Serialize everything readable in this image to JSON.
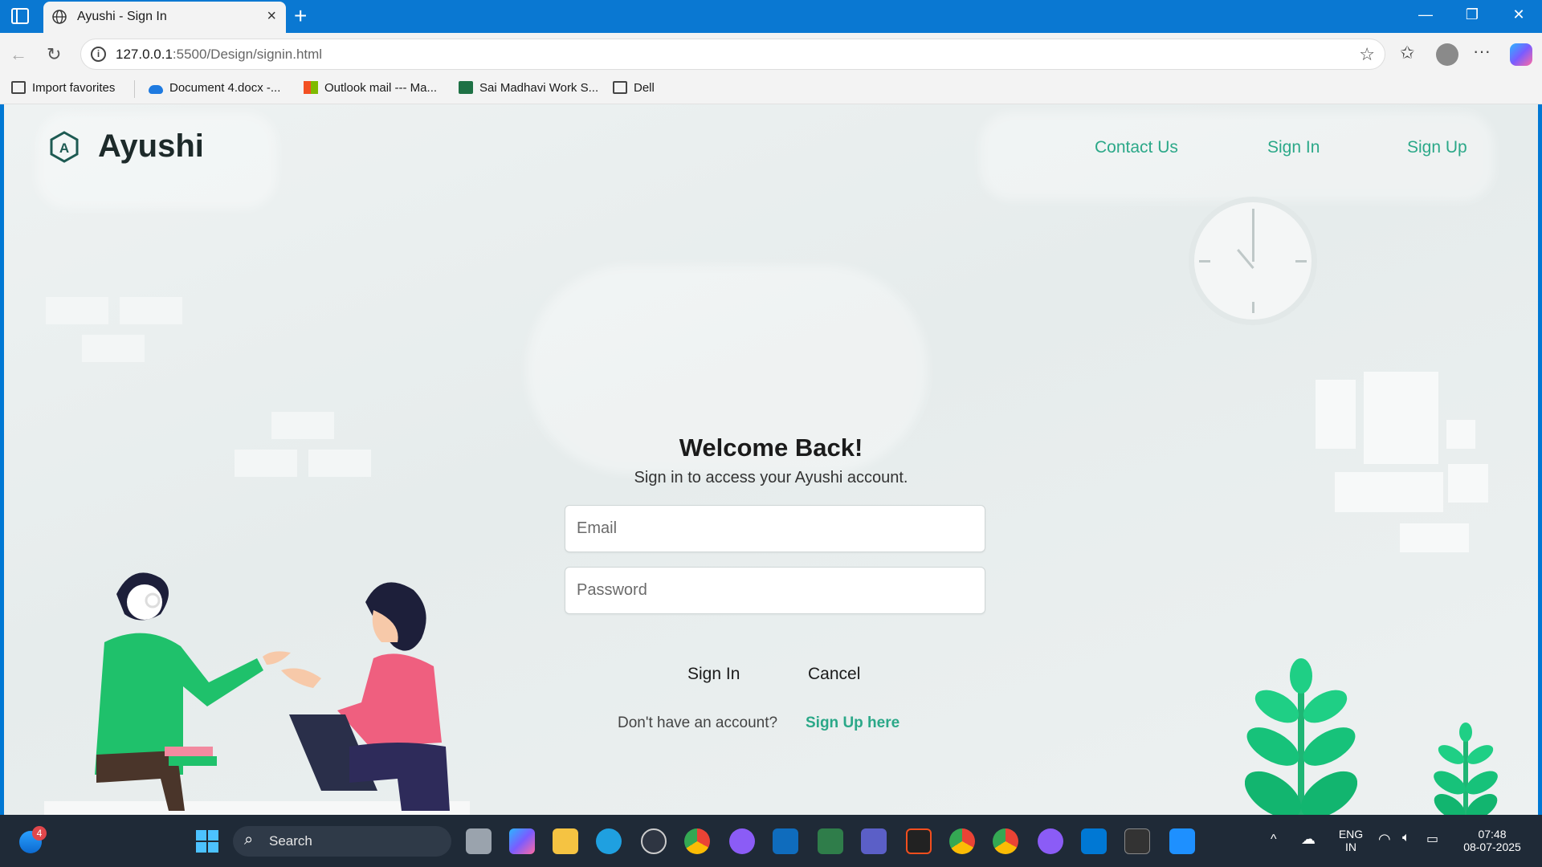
{
  "browser": {
    "tab_title": "Ayushi - Sign In",
    "url_main": "127.0.0.1",
    "url_rest": ":5500/Design/signin.html",
    "bookmarks": [
      "Import favorites",
      "Document 4.docx -...",
      "Outlook mail --- Ma...",
      "Sai Madhavi Work S...",
      "Dell"
    ]
  },
  "site": {
    "brand": "Ayushi",
    "nav": [
      "Contact Us",
      "Sign In",
      "Sign Up"
    ],
    "accent_color": "#2ba888"
  },
  "form": {
    "title": "Welcome Back!",
    "subtitle": "Sign in to access your Ayushi account.",
    "email_placeholder": "Email",
    "password_placeholder": "Password",
    "signin_label": "Sign In",
    "cancel_label": "Cancel",
    "no_account_text": "Don't have an account?",
    "signup_link": "Sign Up here"
  },
  "taskbar": {
    "search_label": "Search",
    "notification_count": "4",
    "lang": "ENG",
    "region": "IN",
    "time": "07:48",
    "date": "08-07-2025"
  }
}
